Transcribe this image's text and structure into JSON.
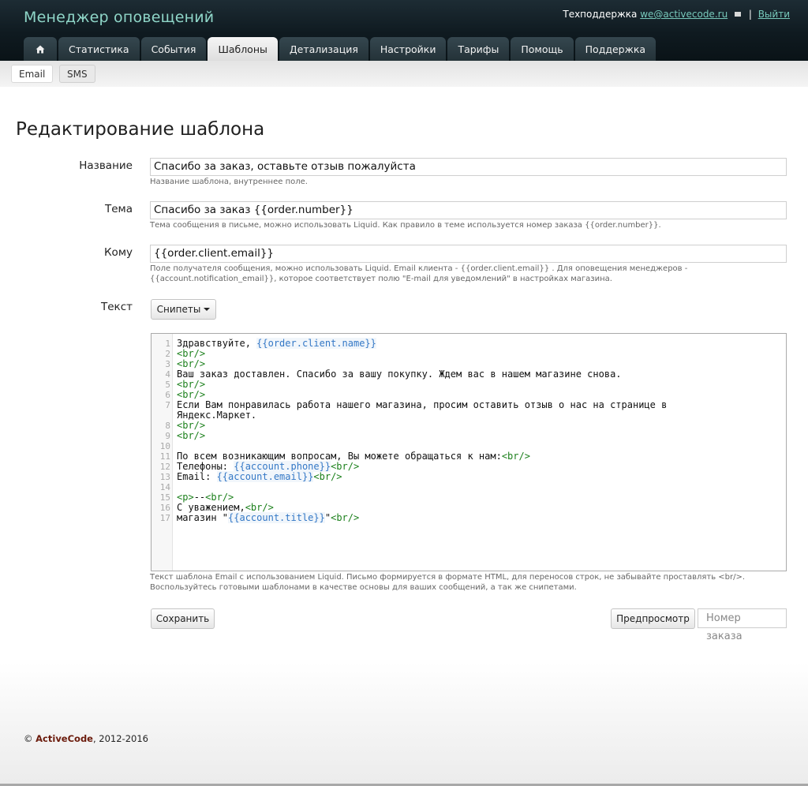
{
  "header": {
    "app_title": "Менеджер оповещений",
    "support_label": "Техподдержка",
    "support_email": "we@activecode.ru",
    "separator": "|",
    "logout_label": "Выйти"
  },
  "tabs": [
    {
      "label": "Статистика"
    },
    {
      "label": "События"
    },
    {
      "label": "Шаблоны"
    },
    {
      "label": "Детализация"
    },
    {
      "label": "Настройки"
    },
    {
      "label": "Тарифы"
    },
    {
      "label": "Помощь"
    },
    {
      "label": "Поддержка"
    }
  ],
  "home_tab_icon": "home-icon",
  "subtabs": [
    {
      "label": "Email"
    },
    {
      "label": "SMS"
    }
  ],
  "page": {
    "title": "Редактирование шаблона"
  },
  "form": {
    "name_label": "Название",
    "name_value": "Спасибо за заказ, оставьте отзыв пожалуйста",
    "name_hint": "Название шаблона, внутреннее поле.",
    "subject_label": "Тема",
    "subject_value": "Спасибо за заказ {{order.number}}",
    "subject_hint": "Тема сообщения в письме, можно использовать Liquid. Как правило в теме используется номер заказа {{order.number}}.",
    "to_label": "Кому",
    "to_value": "{{order.client.email}}",
    "to_hint": "Поле получателя сообщения, можно использовать Liquid. Email клиента - {{order.client.email}} . Для оповещения менеджеров - {{account.notification_email}}, которое соответствует полю \"E-mail для уведомлений\" в настройках магазина.",
    "text_label": "Текст",
    "snippets_label": "Снипеты",
    "text_hint": "Текст шаблона Email с использованием Liquid. Письмо формируется в формате HTML, для переносов строк, не забывайте проставлять <br/>. Воспользуйтесь готовыми шаблонами в качестве основы для ваших сообщений, а так же снипетами.",
    "save_label": "Сохранить",
    "preview_label": "Предпросмотр",
    "order_number_placeholder": "Номер заказа"
  },
  "editor": {
    "lines": [
      {
        "n": "1",
        "parts": [
          [
            "Здравствуйте, ",
            "t"
          ],
          [
            "{{order.client.name}}",
            "l"
          ]
        ]
      },
      {
        "n": "2",
        "parts": [
          [
            "<br/>",
            "g"
          ]
        ]
      },
      {
        "n": "3",
        "parts": [
          [
            "<br/>",
            "g"
          ]
        ]
      },
      {
        "n": "4",
        "parts": [
          [
            "Ваш заказ доставлен. Спасибо за вашу покупку. Ждем вас в нашем магазине снова.",
            "t"
          ]
        ]
      },
      {
        "n": "5",
        "parts": [
          [
            "<br/>",
            "g"
          ]
        ]
      },
      {
        "n": "6",
        "parts": [
          [
            "<br/>",
            "g"
          ]
        ]
      },
      {
        "n": "7",
        "parts": [
          [
            "Если Вам понравилась работа нашего магазина, просим оставить отзыв о нас на странице в",
            "t"
          ]
        ]
      },
      {
        "n": "",
        "parts": [
          [
            "Яндекс.Маркет.",
            "t"
          ]
        ]
      },
      {
        "n": "8",
        "parts": [
          [
            "<br/>",
            "g"
          ]
        ]
      },
      {
        "n": "9",
        "parts": [
          [
            "<br/>",
            "g"
          ]
        ]
      },
      {
        "n": "10",
        "parts": []
      },
      {
        "n": "11",
        "parts": [
          [
            "По всем возникающим вопросам, Вы можете обращаться к нам:",
            "t"
          ],
          [
            "<br/>",
            "g"
          ]
        ]
      },
      {
        "n": "12",
        "parts": [
          [
            "Телефоны: ",
            "t"
          ],
          [
            "{{account.phone}}",
            "l"
          ],
          [
            "<br/>",
            "g"
          ]
        ]
      },
      {
        "n": "13",
        "parts": [
          [
            "Email: ",
            "t"
          ],
          [
            "{{account.email}}",
            "l"
          ],
          [
            "<br/>",
            "g"
          ]
        ]
      },
      {
        "n": "14",
        "parts": []
      },
      {
        "n": "15",
        "parts": [
          [
            "<p>",
            "g"
          ],
          [
            "--",
            "t"
          ],
          [
            "<br/>",
            "g"
          ]
        ]
      },
      {
        "n": "16",
        "parts": [
          [
            "С уважением,",
            "t"
          ],
          [
            "<br/>",
            "g"
          ]
        ]
      },
      {
        "n": "17",
        "parts": [
          [
            "магазин \"",
            "t"
          ],
          [
            "{{account.title}}",
            "l"
          ],
          [
            "\"",
            "t"
          ],
          [
            "<br/>",
            "g"
          ]
        ]
      }
    ]
  },
  "footer": {
    "copyright_symbol": "©",
    "brand": "ActiveCode",
    "years": ", 2012-2016"
  }
}
